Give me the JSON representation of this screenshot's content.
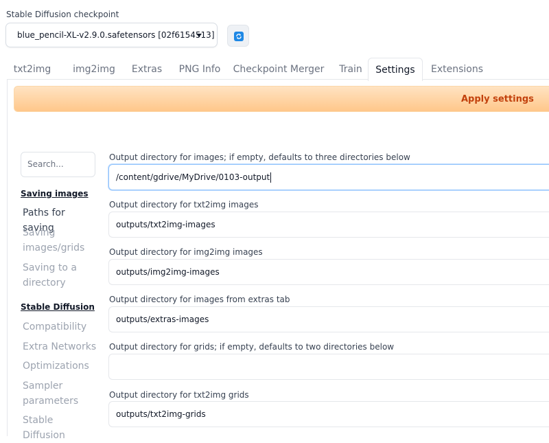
{
  "checkpoint": {
    "label": "Stable Diffusion checkpoint",
    "selected": "blue_pencil-XL-v2.9.0.safetensors [02f6154513]"
  },
  "tabs": [
    {
      "label": "txt2img"
    },
    {
      "label": "img2img"
    },
    {
      "label": "Extras"
    },
    {
      "label": "PNG Info"
    },
    {
      "label": "Checkpoint Merger"
    },
    {
      "label": "Train"
    },
    {
      "label": "Settings"
    },
    {
      "label": "Extensions"
    }
  ],
  "active_tab": "Settings",
  "apply_label": "Apply settings",
  "search": {
    "placeholder": "Search..."
  },
  "sidebar": {
    "saving_images": "Saving images",
    "paths_for_saving": "Paths for saving",
    "saving_grids": "Saving images/grids",
    "saving_to_dir": "Saving to a directory",
    "stable_diffusion": "Stable Diffusion",
    "compatibility": "Compatibility",
    "extra_networks": "Extra Networks",
    "optimizations": "Optimizations",
    "sampler_params": "Sampler parameters",
    "stable_diffusion_item": "Stable Diffusion"
  },
  "fields": [
    {
      "label": "Output directory for images; if empty, defaults to three directories below",
      "value": "/content/gdrive/MyDrive/0103-output"
    },
    {
      "label": "Output directory for txt2img images",
      "value": "outputs/txt2img-images"
    },
    {
      "label": "Output directory for img2img images",
      "value": "outputs/img2img-images"
    },
    {
      "label": "Output directory for images from extras tab",
      "value": "outputs/extras-images"
    },
    {
      "label": "Output directory for grids; if empty, defaults to two directories below",
      "value": ""
    },
    {
      "label": "Output directory for txt2img grids",
      "value": "outputs/txt2img-grids"
    }
  ]
}
